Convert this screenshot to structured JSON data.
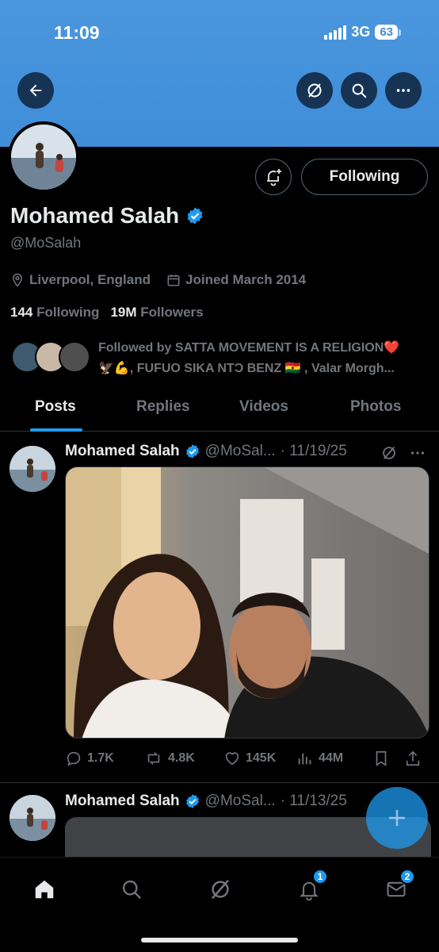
{
  "status_bar": {
    "time": "11:09",
    "network": "3G",
    "battery": "63"
  },
  "header": {
    "back_icon": "arrow-left-icon",
    "grok_icon": "grok-icon",
    "search_icon": "search-icon",
    "more_icon": "more-horizontal-icon"
  },
  "profile": {
    "name": "Mohamed Salah",
    "handle": "@MoSalah",
    "location": "Liverpool, England",
    "joined": "Joined March 2014",
    "following_count": "144",
    "following_label": "Following",
    "followers_count": "19M",
    "followers_label": "Followers",
    "follow_button": "Following",
    "followed_by_line1": "Followed by SATTA MOVEMENT IS A RELIGION❤️",
    "followed_by_line2": "🦅💪, FUFUO SIKA NTƆ BENZ 🇬🇭 , Valar Morgh..."
  },
  "tabs": [
    {
      "label": "Posts",
      "active": true
    },
    {
      "label": "Replies",
      "active": false
    },
    {
      "label": "Videos",
      "active": false
    },
    {
      "label": "Photos",
      "active": false
    }
  ],
  "posts": [
    {
      "name": "Mohamed Salah",
      "handle": "@MoSal...",
      "date": "· 11/19/25",
      "replies": "1.7K",
      "reposts": "4.8K",
      "likes": "145K",
      "views": "44M"
    },
    {
      "name": "Mohamed Salah",
      "handle": "@MoSal...",
      "date": "· 11/13/25"
    }
  ],
  "bottom_nav": {
    "notifications_badge": "1",
    "messages_badge": "2"
  },
  "colors": {
    "banner": "#3f8ed9",
    "accent": "#1d9bf0",
    "muted": "#71767b",
    "text": "#e7e9ea"
  }
}
